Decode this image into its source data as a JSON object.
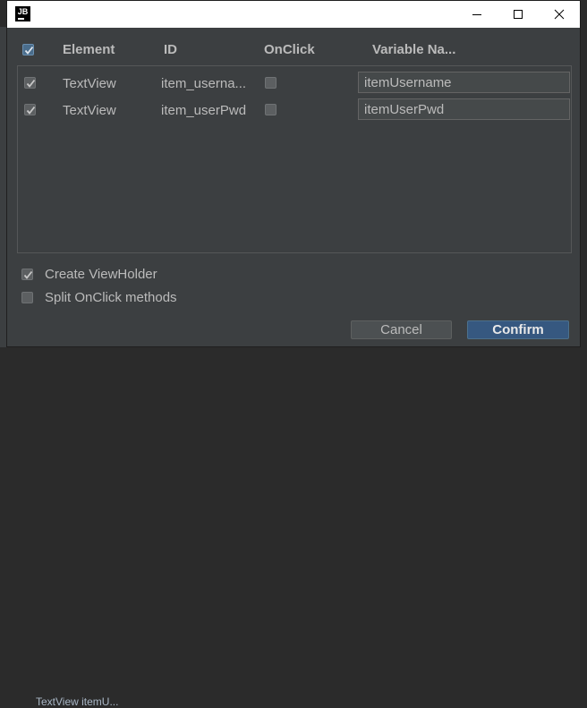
{
  "dialog": {
    "logo_text": "JB",
    "window_controls": [
      "minimize-icon",
      "maximize-icon",
      "close-icon"
    ]
  },
  "table": {
    "headers": {
      "select_all_checked": true,
      "element": "Element",
      "id": "ID",
      "onclick": "OnClick",
      "variable_name": "Variable Na..."
    },
    "rows": [
      {
        "checked": true,
        "element": "TextView",
        "id": "item_userna...",
        "onclick": false,
        "variable_name": "itemUsername"
      },
      {
        "checked": true,
        "element": "TextView",
        "id": "item_userPwd",
        "onclick": false,
        "variable_name": "itemUserPwd"
      }
    ]
  },
  "options": {
    "create_viewholder": {
      "label": "Create ViewHolder",
      "checked": true
    },
    "split_onclick": {
      "label": "Split OnClick methods",
      "checked": false
    }
  },
  "buttons": {
    "cancel": "Cancel",
    "confirm": "Confirm"
  },
  "background": {
    "partial_text": "TextView  itemU..."
  },
  "colors": {
    "dialog_bg": "#3c3f41",
    "titlebar_bg": "#ffffff",
    "text": "#bbbbbb",
    "primary_button": "#365880",
    "input_bg": "#45494a"
  }
}
